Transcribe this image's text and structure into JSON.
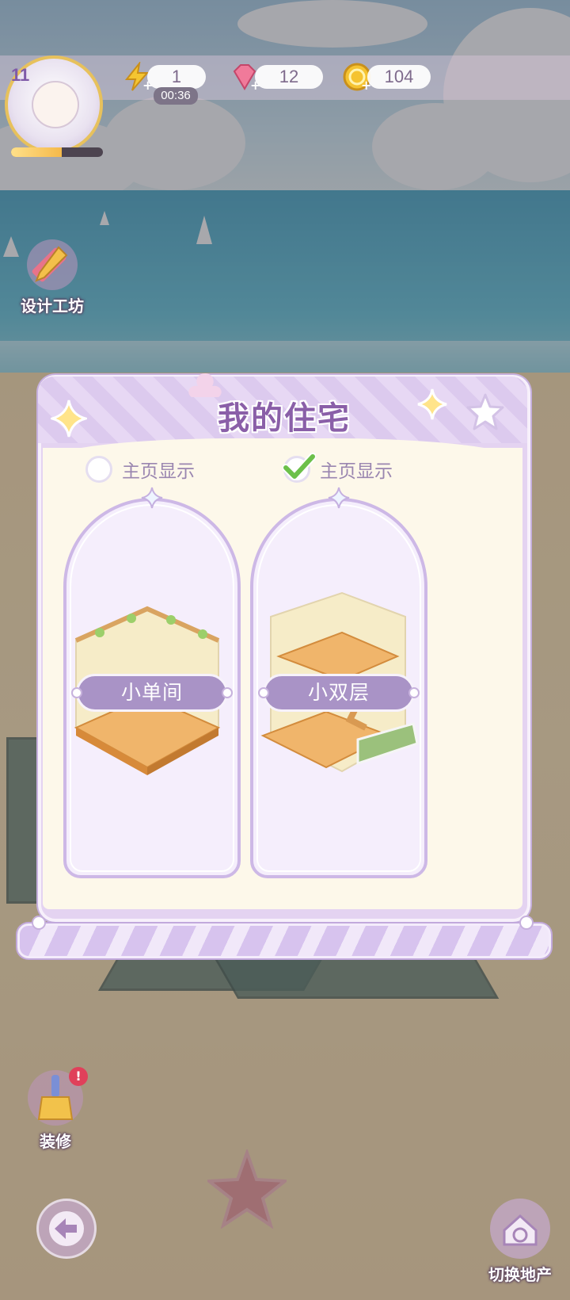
{
  "hud": {
    "level": "11",
    "energy": "1",
    "energy_timer": "00:36",
    "gems": "12",
    "coins": "104",
    "exp_progress": 0.55
  },
  "side": {
    "design_workshop": "设计工坊",
    "decorate": "装修",
    "switch_estate": "切换地产"
  },
  "dialog": {
    "title": "我的住宅",
    "options": [
      {
        "label": "主页显示",
        "checked": false
      },
      {
        "label": "主页显示",
        "checked": true
      }
    ],
    "houses": [
      {
        "name": "小单间"
      },
      {
        "name": "小双层"
      }
    ]
  },
  "colors": {
    "accent_purple": "#8a5fa8",
    "panel_cream": "#fdf8ea",
    "check_green": "#6cc04a"
  }
}
